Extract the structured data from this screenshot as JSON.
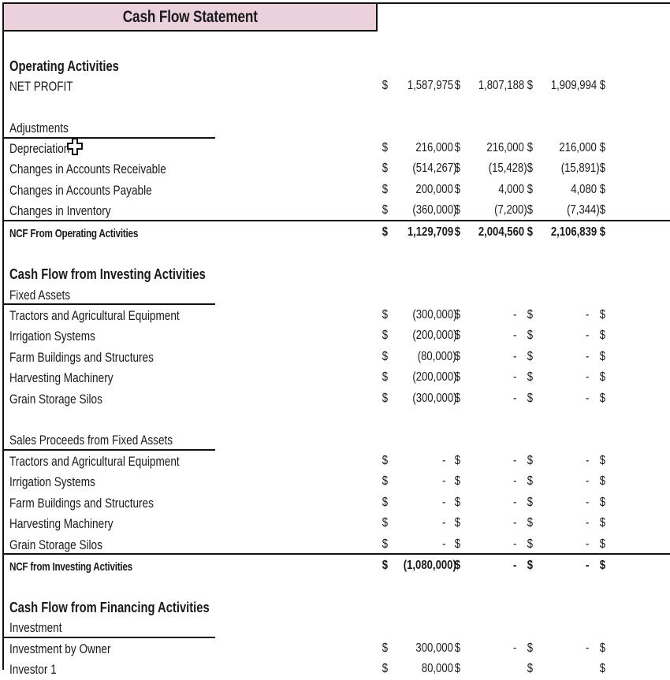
{
  "title": "Cash Flow Statement",
  "currency_symbol": "$",
  "operating": {
    "heading": "Operating Activities",
    "net_profit": {
      "label": "NET PROFIT",
      "values": [
        "1,587,975",
        "1,807,188",
        "1,909,994",
        ""
      ]
    },
    "adjustments_label": "Adjustments",
    "adjustments": [
      {
        "label": "Depreciation",
        "values": [
          "216,000",
          "216,000",
          "216,000",
          ""
        ]
      },
      {
        "label": "Changes in Accounts Receivable",
        "values": [
          "(514,267)",
          "(15,428)",
          "(15,891)",
          ""
        ]
      },
      {
        "label": "Changes in Accounts Payable",
        "values": [
          "200,000",
          "4,000",
          "4,080",
          ""
        ]
      },
      {
        "label": "Changes in Inventory",
        "values": [
          "(360,000)",
          "(7,200)",
          "(7,344)",
          ""
        ]
      }
    ],
    "total": {
      "label": "NCF From Operating Activities",
      "values": [
        "1,129,709",
        "2,004,560",
        "2,106,839",
        ""
      ]
    }
  },
  "investing": {
    "heading": "Cash Flow from Investing Activities",
    "fixed_assets_label": "Fixed Assets",
    "fixed_assets": [
      {
        "label": "Tractors and Agricultural Equipment",
        "values": [
          "(300,000)",
          "-",
          "-",
          ""
        ]
      },
      {
        "label": "Irrigation Systems",
        "values": [
          "(200,000)",
          "-",
          "-",
          ""
        ]
      },
      {
        "label": "Farm Buildings and Structures",
        "values": [
          "(80,000)",
          "-",
          "-",
          ""
        ]
      },
      {
        "label": "Harvesting Machinery",
        "values": [
          "(200,000)",
          "-",
          "-",
          ""
        ]
      },
      {
        "label": "Grain Storage Silos",
        "values": [
          "(300,000)",
          "-",
          "-",
          ""
        ]
      }
    ],
    "sales_label": "Sales Proceeds from Fixed Assets",
    "sales": [
      {
        "label": "Tractors and Agricultural Equipment",
        "values": [
          "-",
          "-",
          "-",
          ""
        ]
      },
      {
        "label": "Irrigation Systems",
        "values": [
          "-",
          "-",
          "-",
          ""
        ]
      },
      {
        "label": "Farm Buildings and Structures",
        "values": [
          "-",
          "-",
          "-",
          ""
        ]
      },
      {
        "label": "Harvesting Machinery",
        "values": [
          "-",
          "-",
          "-",
          ""
        ]
      },
      {
        "label": "Grain Storage Silos",
        "values": [
          "-",
          "-",
          "-",
          ""
        ]
      }
    ],
    "total": {
      "label": "NCF from Investing Activities",
      "values": [
        "(1,080,000)",
        "-",
        "-",
        ""
      ]
    }
  },
  "financing": {
    "heading": "Cash Flow from Financing Activities",
    "investment_label": "Investment",
    "items": [
      {
        "label": "Investment by Owner",
        "values": [
          "300,000",
          "-",
          "-",
          ""
        ]
      },
      {
        "label": "Investor 1",
        "values": [
          "80,000",
          "",
          "",
          ""
        ]
      }
    ]
  }
}
